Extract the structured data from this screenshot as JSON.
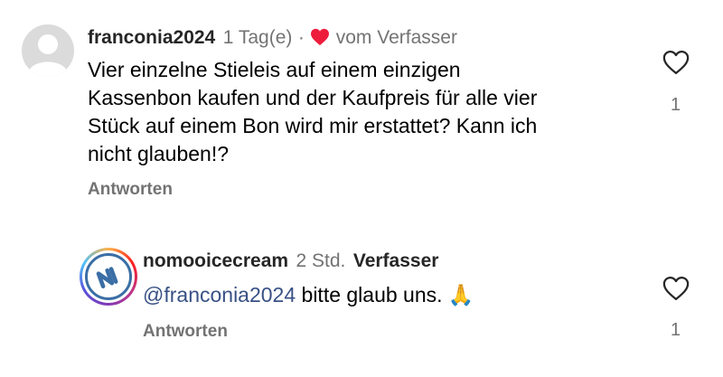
{
  "comments": [
    {
      "username": "franconia2024",
      "time": "1 Tag(e)",
      "separator": "·",
      "liked_by_author": "vom Verfasser",
      "text_lines": [
        "Vier einzelne Stieleis auf einem einzigen",
        "Kassenbon kaufen und der Kaufpreis für alle vier",
        "Stück auf einem Bon wird mir erstattet? Kann ich",
        "nicht glauben!?"
      ],
      "reply_label": "Antworten",
      "like_count": "1"
    },
    {
      "username": "nomooicecream",
      "time": "2 Std.",
      "author_badge": "Verfasser",
      "mention": "@franconia2024",
      "text": " bitte glaub uns. 🙏",
      "reply_label": "Antworten",
      "like_count": "1"
    }
  ],
  "colors": {
    "heart_red": "#ed1c3b",
    "muted": "#737373",
    "mention": "#385185"
  },
  "icons": {
    "like_outline": "heart-outline-icon",
    "author_heart": "heart-filled-icon"
  }
}
